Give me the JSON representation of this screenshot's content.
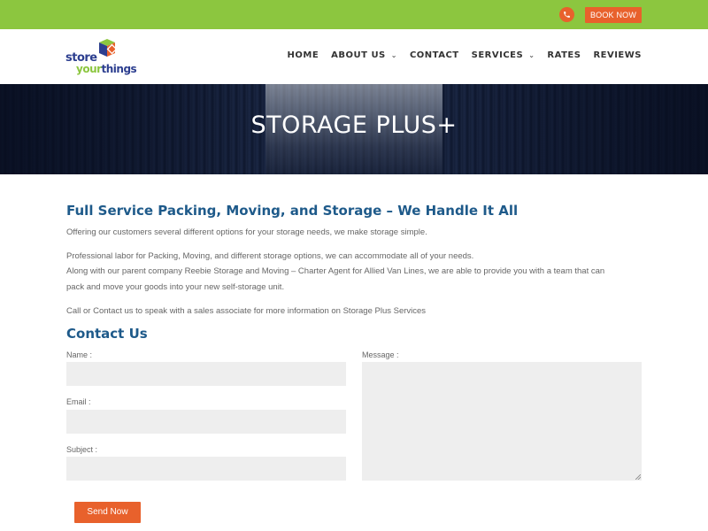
{
  "topbar": {
    "book_label": "BOOK NOW",
    "phone_icon": "phone-icon"
  },
  "brand": {
    "word1": "store",
    "word2a": "your",
    "word2b": "things"
  },
  "nav": {
    "items": [
      {
        "label": "HOME"
      },
      {
        "label": "ABOUT US",
        "dropdown": true
      },
      {
        "label": "CONTACT"
      },
      {
        "label": "SERVICES",
        "dropdown": true
      },
      {
        "label": "RATES"
      },
      {
        "label": "REVIEWS"
      }
    ],
    "chevron": "⌄"
  },
  "hero": {
    "title": "STORAGE PLUS+"
  },
  "main": {
    "heading": "Full Service Packing, Moving, and Storage – We Handle It All",
    "p1": "Offering our customers several different options for your storage needs, we make storage simple.",
    "p2a": "Professional labor for Packing, Moving, and different storage options, we can accommodate all of your needs.",
    "p2b": "Along with our parent company Reebie Storage and Moving – Charter Agent for Allied Van Lines, we are able to provide you with a team that can",
    "p2c": "pack and move your goods into your new self-storage unit.",
    "p3": "Call or Contact us to speak with a sales associate for more information on Storage Plus Services"
  },
  "contact": {
    "heading": "Contact Us",
    "name_label": "Name :",
    "email_label": "Email :",
    "subject_label": "Subject :",
    "message_label": "Message :",
    "send_label": "Send Now"
  },
  "colors": {
    "accent": "#e8612c",
    "brand_green": "#8cc63f",
    "heading_blue": "#1e5a8a"
  }
}
